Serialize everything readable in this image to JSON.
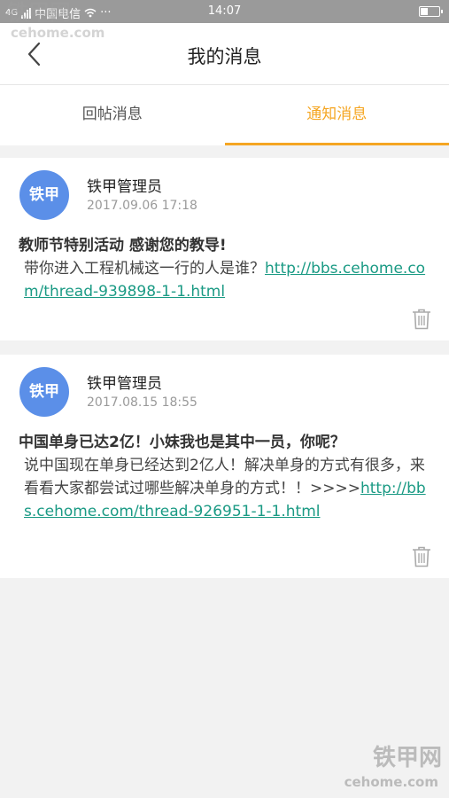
{
  "status_bar": {
    "network": "4G",
    "carrier": "中国电信",
    "dots": "···",
    "time": "14:07",
    "battery_level": 0.4
  },
  "watermark": {
    "brand": "铁甲网",
    "domain": "cehome.com"
  },
  "header": {
    "title": "我的消息"
  },
  "tabs": [
    {
      "label": "回帖消息",
      "active": false
    },
    {
      "label": "通知消息",
      "active": true
    }
  ],
  "messages": [
    {
      "avatar_text": "铁甲",
      "sender": "铁甲管理员",
      "time": "2017.09.06 17:18",
      "headline": "教师节特别活动 感谢您的教导!",
      "text": "带你进入工程机械这一行的人是谁？",
      "link": "http://bbs.cehome.com/thread-939898-1-1.html"
    },
    {
      "avatar_text": "铁甲",
      "sender": "铁甲管理员",
      "time": "2017.08.15 18:55",
      "headline": "中国单身已达2亿！小妹我也是其中一员，你呢？",
      "text": "说中国现在单身已经达到2亿人！解决单身的方式有很多，来看看大家都尝试过哪些解决单身的方式！！>>>>",
      "link": "http://bbs.cehome.com/thread-926951-1-1.html"
    }
  ],
  "colors": {
    "accent": "#f5a623",
    "link": "#1a9a84",
    "avatar": "#5b8fe8"
  }
}
